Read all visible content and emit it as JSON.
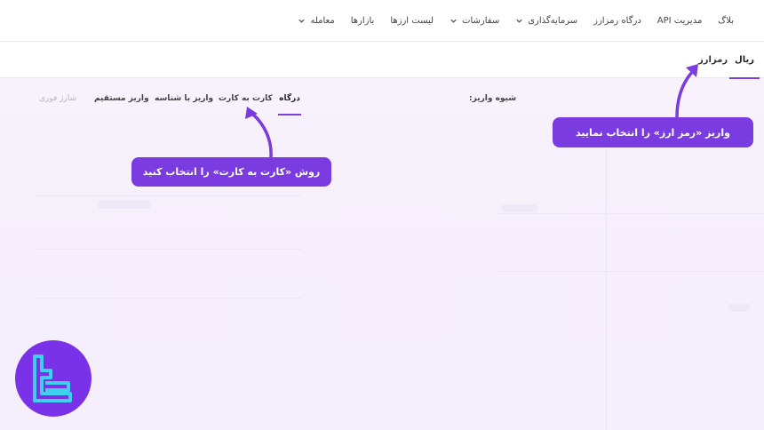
{
  "nav": {
    "items": [
      {
        "label": "معامله",
        "dropdown": true
      },
      {
        "label": "بازارها",
        "dropdown": false
      },
      {
        "label": "لیست ارزها",
        "dropdown": false
      },
      {
        "label": "سفارشات",
        "dropdown": true
      },
      {
        "label": "سرمایه‌گذاری",
        "dropdown": true
      },
      {
        "label": "درگاه رمزارز",
        "dropdown": false
      },
      {
        "label": "مدیریت API",
        "dropdown": false
      },
      {
        "label": "بلاگ",
        "dropdown": false
      }
    ]
  },
  "currency_tabs": {
    "rial": "ریال",
    "crypto": "رمزارز"
  },
  "deposit": {
    "method_label": "شیوه واریز:",
    "methods": {
      "gateway": "درگاه",
      "card_to_card": "کارت به کارت",
      "with_id": "واریز با شناسه",
      "direct": "واریز مستقیم",
      "instant_charge": "شارژ فوری"
    }
  },
  "callouts": {
    "crypto_hint": "واریز «رمز ارز» را انتخاب نمایید",
    "card_hint": "روش «کارت به کارت» را انتخاب کنید"
  },
  "colors": {
    "accent": "#7a3be0",
    "logo_bg": "#7a32e8",
    "logo_mark": "#3fd0f0"
  },
  "logo": {
    "icon": "tradingfinder-logo-icon"
  }
}
